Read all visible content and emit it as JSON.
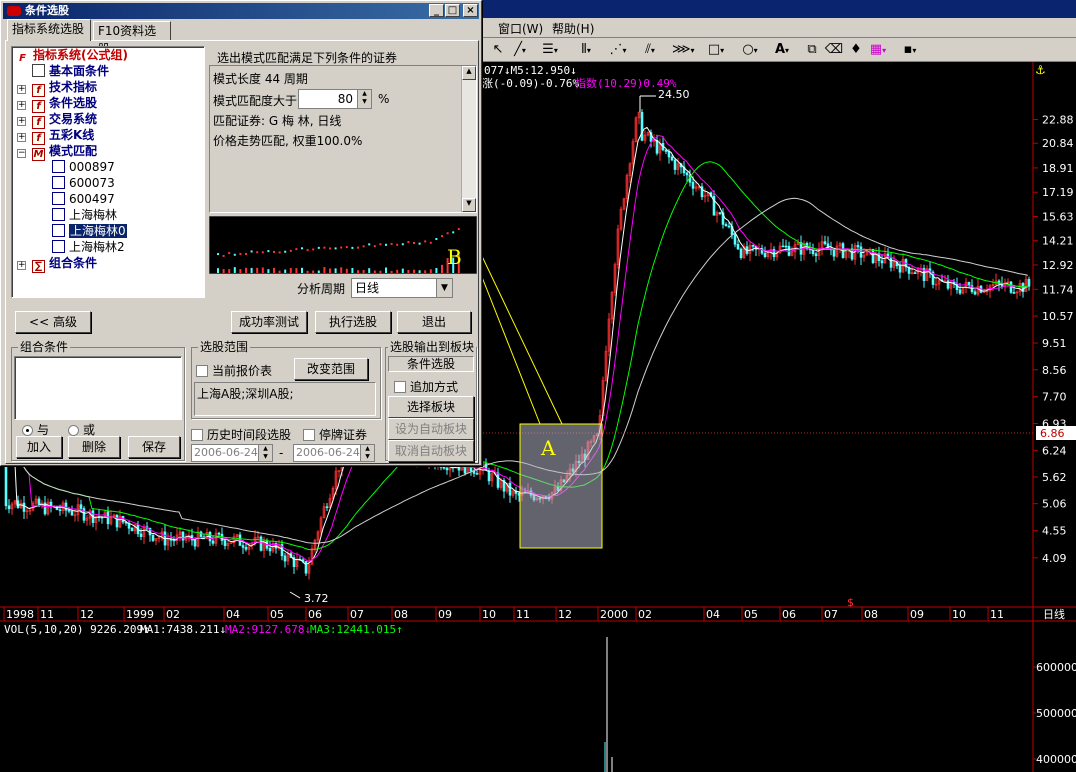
{
  "menu": {
    "window": "窗口(W)",
    "help": "帮助(H)"
  },
  "toolbar": {
    "text_tool": "A",
    "icons": [
      "cursor-icon",
      "line-icon",
      "channel-icon",
      "vertical-lines-icon",
      "fan-icon",
      "parallel-icon",
      "hatch-icon",
      "rectangle-icon",
      "ellipse-icon",
      "text-icon",
      "copy-icon",
      "eraser-icon",
      "color-palette-icon",
      "save-icon"
    ]
  },
  "dialog": {
    "title": "条件选股",
    "tabs": [
      "指标系统选股",
      "F10资料选股"
    ],
    "tree": {
      "root": "指标系统(公式组)",
      "items": [
        "基本面条件",
        "技术指标",
        "条件选股",
        "交易系统",
        "五彩K线",
        "模式匹配"
      ],
      "patterns": [
        "000897",
        "600073",
        "600497",
        "上海梅林",
        "上海梅林0",
        "上海梅林2"
      ],
      "combo": "组合条件"
    },
    "desc": {
      "heading": "选出模式匹配满足下列条件的证券",
      "length": "模式长度 44 周期",
      "match_label": "模式匹配度大于",
      "match_value": "80",
      "match_unit": "%",
      "security": "匹配证券: G 梅  林, 日线",
      "method": "价格走势匹配, 权重100.0%"
    },
    "preview_marker": "B",
    "period_label": "分析周期",
    "period_value": "日线",
    "buttons": {
      "advanced": "<< 高级",
      "test": "成功率测试",
      "run": "执行选股",
      "exit": "退出"
    },
    "combo_group": {
      "label": "组合条件",
      "and": "与",
      "or": "或",
      "add": "加入",
      "delete": "删除",
      "save": "保存"
    },
    "range_group": {
      "label": "选股范围",
      "current_quote": "当前报价表",
      "change": "改变范围",
      "markets": "上海A股;深圳A股;",
      "history": "历史时间段选股",
      "suspended": "停牌证券",
      "date_from": "2006-06-24",
      "date_sep": "-",
      "date_to": "2006-06-24"
    },
    "output_group": {
      "label": "选股输出到板块",
      "target": "条件选股",
      "append": "追加方式",
      "select": "选择板块",
      "set_auto": "设为自动板块",
      "cancel_auto": "取消自动板块"
    }
  },
  "chart": {
    "ma_info": "077↓M5:12.950↓",
    "change_info": "涨(-0.09)-0.76%",
    "index_info": "指数(10.29)0.49%",
    "peak_label": "24.50",
    "low_label": "3.72",
    "box_label": "A",
    "current_price": "6.86",
    "period": "日线",
    "y_ticks": [
      "22.88",
      "20.84",
      "18.91",
      "17.19",
      "15.63",
      "14.21",
      "12.92",
      "11.74",
      "10.57",
      "9.51",
      "8.56",
      "7.70",
      "6.93",
      "6.24",
      "5.62",
      "5.06",
      "4.55",
      "4.09"
    ],
    "x_ticks": [
      "1998",
      "11",
      "12",
      "1999",
      "02",
      "04",
      "05",
      "06",
      "07",
      "08",
      "09",
      "10",
      "11",
      "12",
      "2000",
      "02",
      "04",
      "05",
      "06",
      "07",
      "08",
      "09",
      "10",
      "11"
    ],
    "vol_info": "VOL(5,10,20) 9226.209↑",
    "vol_ma1": "MA1:7438.211↓",
    "vol_ma2": "MA2:9127.678↓",
    "vol_ma3": "MA3:12441.015↑",
    "vol_ticks": [
      "600000",
      "500000",
      "400000"
    ]
  },
  "chart_data": {
    "type": "line",
    "title": "",
    "x": [
      "1998",
      "11",
      "12",
      "1999",
      "02",
      "04",
      "05",
      "06",
      "07",
      "08",
      "09",
      "10",
      "11",
      "12",
      "2000",
      "02",
      "04",
      "05",
      "06",
      "07",
      "08",
      "09",
      "10",
      "11"
    ],
    "series": [
      {
        "values": [
          5.1,
          5.0,
          4.9,
          4.7,
          4.4,
          4.4,
          4.3,
          3.9,
          6.5,
          6.2,
          6.0,
          5.8,
          5.2,
          5.3,
          6.6,
          22.0,
          17.0,
          13.5,
          13.8,
          13.8,
          13.5,
          12.8,
          11.8,
          11.9
        ]
      }
    ],
    "ylim": [
      3.72,
      24.5
    ],
    "scale": "log",
    "grid": false
  },
  "colors": {
    "bg": "#000000",
    "up": "#ff3232",
    "down": "#54ffff",
    "ma1": "#ffffff",
    "ma2": "#ff00ff",
    "ma3": "#00ff00",
    "ma4": "#d0d0d0",
    "axis": "#c00000",
    "label": "#ffff00"
  }
}
